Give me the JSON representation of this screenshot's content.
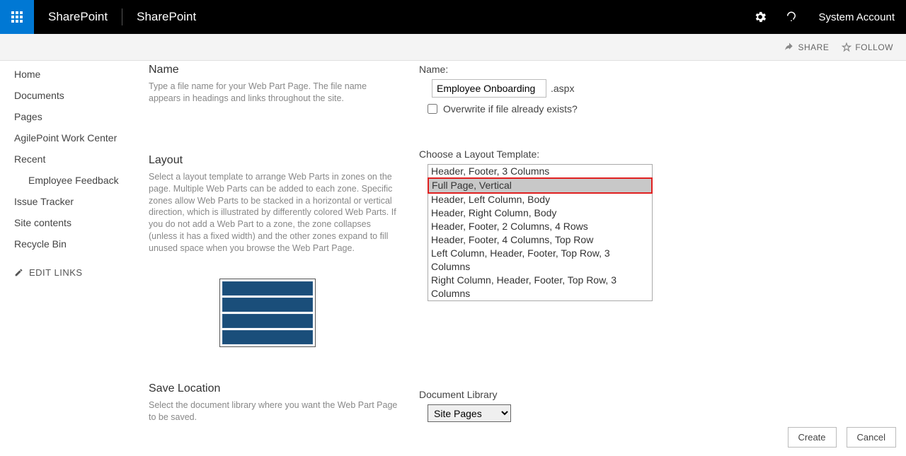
{
  "topbar": {
    "brand1": "SharePoint",
    "brand2": "SharePoint",
    "account": "System Account"
  },
  "ribbon": {
    "share": "SHARE",
    "follow": "FOLLOW"
  },
  "sidebar": {
    "items": [
      "Home",
      "Documents",
      "Pages",
      "AgilePoint Work Center",
      "Recent",
      "Employee Feedback",
      "Issue Tracker",
      "Site contents",
      "Recycle Bin"
    ],
    "edit_links": "EDIT LINKS"
  },
  "sections": {
    "name": {
      "title": "Name",
      "desc": "Type a file name for your Web Part Page.  The file name appears in headings and links throughout the site."
    },
    "layout": {
      "title": "Layout",
      "desc": "Select a layout template to arrange Web Parts in zones on the page. Multiple Web Parts can be added to each zone. Specific zones allow Web Parts to be stacked in a horizontal or vertical direction, which is illustrated by differently colored Web Parts. If you do not add a Web Part to a zone, the zone collapses (unless it has a fixed width) and the other zones expand to fill unused space when you browse the Web Part Page."
    },
    "save": {
      "title": "Save Location",
      "desc": "Select the document library where you want the Web Part Page to be saved."
    }
  },
  "form": {
    "name_label": "Name:",
    "name_value": "Employee Onboarding",
    "ext": ".aspx",
    "overwrite_label": "Overwrite if file already exists?",
    "layout_label": "Choose a Layout Template:",
    "layout_options": [
      "Header, Footer, 3 Columns",
      "Full Page, Vertical",
      "Header, Left Column, Body",
      "Header, Right Column, Body",
      "Header, Footer, 2 Columns, 4 Rows",
      "Header, Footer, 4 Columns, Top Row",
      "Left Column, Header, Footer, Top Row, 3 Columns",
      "Right Column, Header, Footer, Top Row, 3 Columns"
    ],
    "doclib_label": "Document Library",
    "doclib_value": "Site Pages"
  },
  "buttons": {
    "create": "Create",
    "cancel": "Cancel"
  }
}
